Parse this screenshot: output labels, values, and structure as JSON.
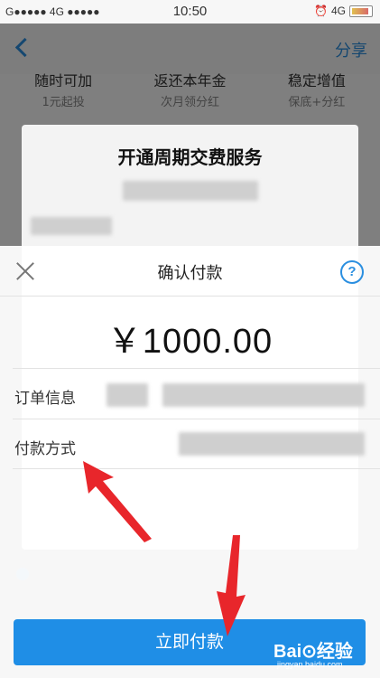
{
  "status_bar": {
    "carrier_left": "G●●●●● 4G ●●●●●",
    "time": "10:50",
    "network_right": "4G"
  },
  "app": {
    "share_label": "分享",
    "features": [
      {
        "title": "随时可加",
        "subtitle": "1元起投"
      },
      {
        "title": "返还本年金",
        "subtitle": "次月领分红"
      },
      {
        "title": "稳定增值",
        "subtitle": "保底+分红"
      }
    ]
  },
  "dialog": {
    "title": "开通周期交费服务"
  },
  "sheet": {
    "title": "确认付款",
    "help_symbol": "?",
    "amount": "￥1000.00",
    "order_label": "订单信息",
    "payment_label": "付款方式",
    "pay_button_label": "立即付款"
  },
  "watermark": {
    "text": "Bai⊙经验",
    "sub": "jingyan.baidu.com"
  },
  "colors": {
    "accent": "#1f8ee6",
    "annotation_arrow": "#e8262b"
  }
}
